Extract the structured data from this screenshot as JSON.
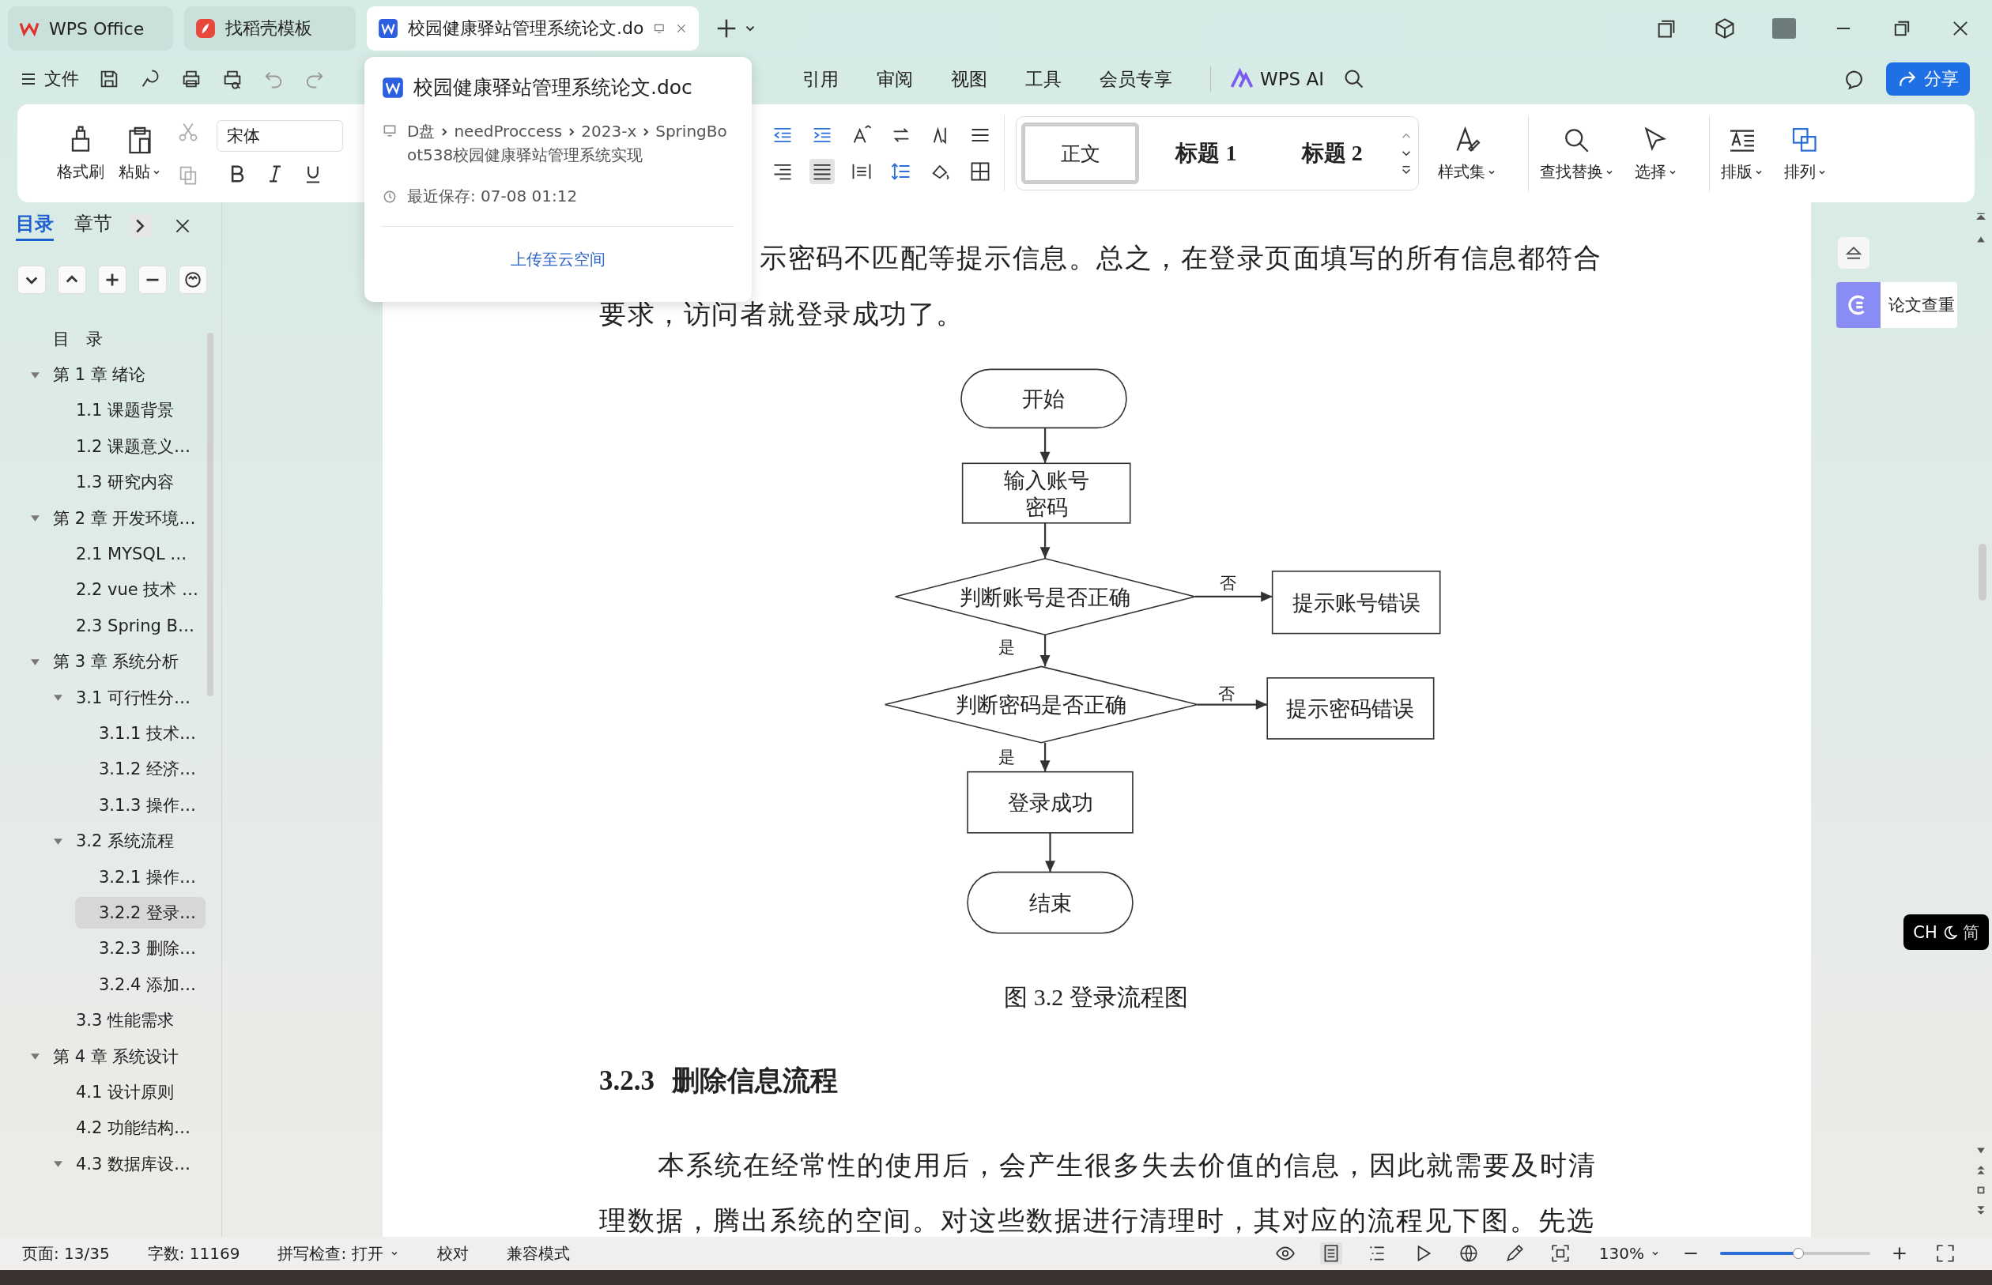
{
  "tabs": [
    {
      "label": "WPS Office",
      "kind": "wps",
      "selected": false
    },
    {
      "label": "找稻壳模板",
      "kind": "docer",
      "selected": false
    },
    {
      "label": "校园健康驿站管理系统论文.do",
      "kind": "doc",
      "selected": true
    }
  ],
  "menu": {
    "file": "文件",
    "items": [
      "引用",
      "审阅",
      "视图",
      "工具",
      "会员专享"
    ],
    "ai": "WPS AI",
    "share": "分享"
  },
  "ribbon": {
    "format_painter": "格式刷",
    "paste": "粘贴",
    "font": "宋体",
    "styles": [
      {
        "label": "正文",
        "selected": true
      },
      {
        "label": "标题 1",
        "selected": false
      },
      {
        "label": "标题 2",
        "selected": false
      }
    ],
    "tools": [
      {
        "label": "样式集",
        "kind": "styles"
      },
      {
        "label": "查找替换",
        "kind": "find"
      },
      {
        "label": "选择",
        "kind": "select"
      },
      {
        "label": "排版",
        "kind": "layout"
      },
      {
        "label": "排列",
        "kind": "arrange"
      }
    ]
  },
  "popup": {
    "title": "校园健康驿站管理系统论文.doc",
    "path": [
      "D盘",
      "needProccess",
      "2023-x",
      "SpringBoot538校园健康驿站管理系统实现"
    ],
    "saved": "最近保存: 07-08 01:12",
    "upload": "上传至云空间"
  },
  "nav": {
    "tabs": [
      {
        "label": "目录",
        "selected": true
      },
      {
        "label": "章节",
        "selected": false
      }
    ],
    "toc": [
      {
        "label": "目　录",
        "selected": false
      },
      {
        "label": "第 1 章  绪论",
        "selected": false,
        "expanded": true,
        "children": [
          {
            "label": "1.1  课题背景",
            "selected": false
          },
          {
            "label": "1.2  课题意义…",
            "selected": false
          },
          {
            "label": "1.3  研究内容",
            "selected": false
          }
        ]
      },
      {
        "label": "第 2 章  开发环境…",
        "selected": false,
        "expanded": true,
        "children": [
          {
            "label": "2.1 MYSQL …",
            "selected": false
          },
          {
            "label": "2.2 vue 技术  …",
            "selected": false
          },
          {
            "label": "2.3 Spring B…",
            "selected": false
          }
        ]
      },
      {
        "label": "第 3 章  系统分析",
        "selected": false,
        "expanded": true,
        "children": [
          {
            "label": "3.1  可行性分…",
            "selected": false,
            "expanded": true,
            "children": [
              {
                "label": "3.1.1  技术…",
                "selected": false
              },
              {
                "label": "3.1.2  经济…",
                "selected": false
              },
              {
                "label": "3.1.3  操作…",
                "selected": false
              }
            ]
          },
          {
            "label": "3.2  系统流程",
            "selected": false,
            "expanded": true,
            "children": [
              {
                "label": "3.2.1  操作…",
                "selected": false
              },
              {
                "label": "3.2.2  登录…",
                "selected": true
              },
              {
                "label": "3.2.3  删除…",
                "selected": false
              },
              {
                "label": "3.2.4  添加…",
                "selected": false
              }
            ]
          },
          {
            "label": "3.3  性能需求",
            "selected": false
          }
        ]
      },
      {
        "label": "第 4 章  系统设计",
        "selected": false,
        "expanded": true,
        "children": [
          {
            "label": "4.1  设计原则",
            "selected": false
          },
          {
            "label": "4.2  功能结构…",
            "selected": false
          },
          {
            "label": "4.3  数据库设…",
            "selected": false,
            "expanded": true
          }
        ]
      }
    ]
  },
  "document": {
    "para1": [
      "示密码不匹配等提示信息。总之，在登录页面填写的所有信息都符合",
      "要求，访问者就登录成功了。"
    ],
    "flowchart": {
      "nodes": [
        {
          "kind": "terminal",
          "lines": [
            "开始"
          ]
        },
        {
          "kind": "process",
          "lines": [
            "输入账号",
            "密码"
          ]
        },
        {
          "kind": "decision",
          "lines": [
            "判断账号是否正确"
          ]
        },
        {
          "kind": "process",
          "lines": [
            "提示账号错误"
          ]
        },
        {
          "kind": "decision",
          "lines": [
            "判断密码是否正确"
          ]
        },
        {
          "kind": "process",
          "lines": [
            "提示密码错误"
          ]
        },
        {
          "kind": "process",
          "lines": [
            "登录成功"
          ]
        },
        {
          "kind": "terminal",
          "lines": [
            "结束"
          ]
        }
      ],
      "labels": [
        "否",
        "是",
        "否",
        "是"
      ]
    },
    "caption": "图 3.2  登录流程图",
    "heading_number": "3.2.3",
    "heading": "删除信息流程",
    "para2": "本系统在经常性的使用后，会产生很多失去价值的信息，因此就需要及时清理数据，腾出系统的空间。对这些数据进行清理时，其对应的流程见下图。先选"
  },
  "side": {
    "check": "论文查重",
    "ime": "CH",
    "ime_mode": "简"
  },
  "status": {
    "page": "页面: 13/35",
    "words": "字数: 11169",
    "spell": "拼写检查: 打开",
    "proofread": "校对",
    "compat": "兼容模式",
    "zoom": "130%",
    "level": 0.52
  }
}
